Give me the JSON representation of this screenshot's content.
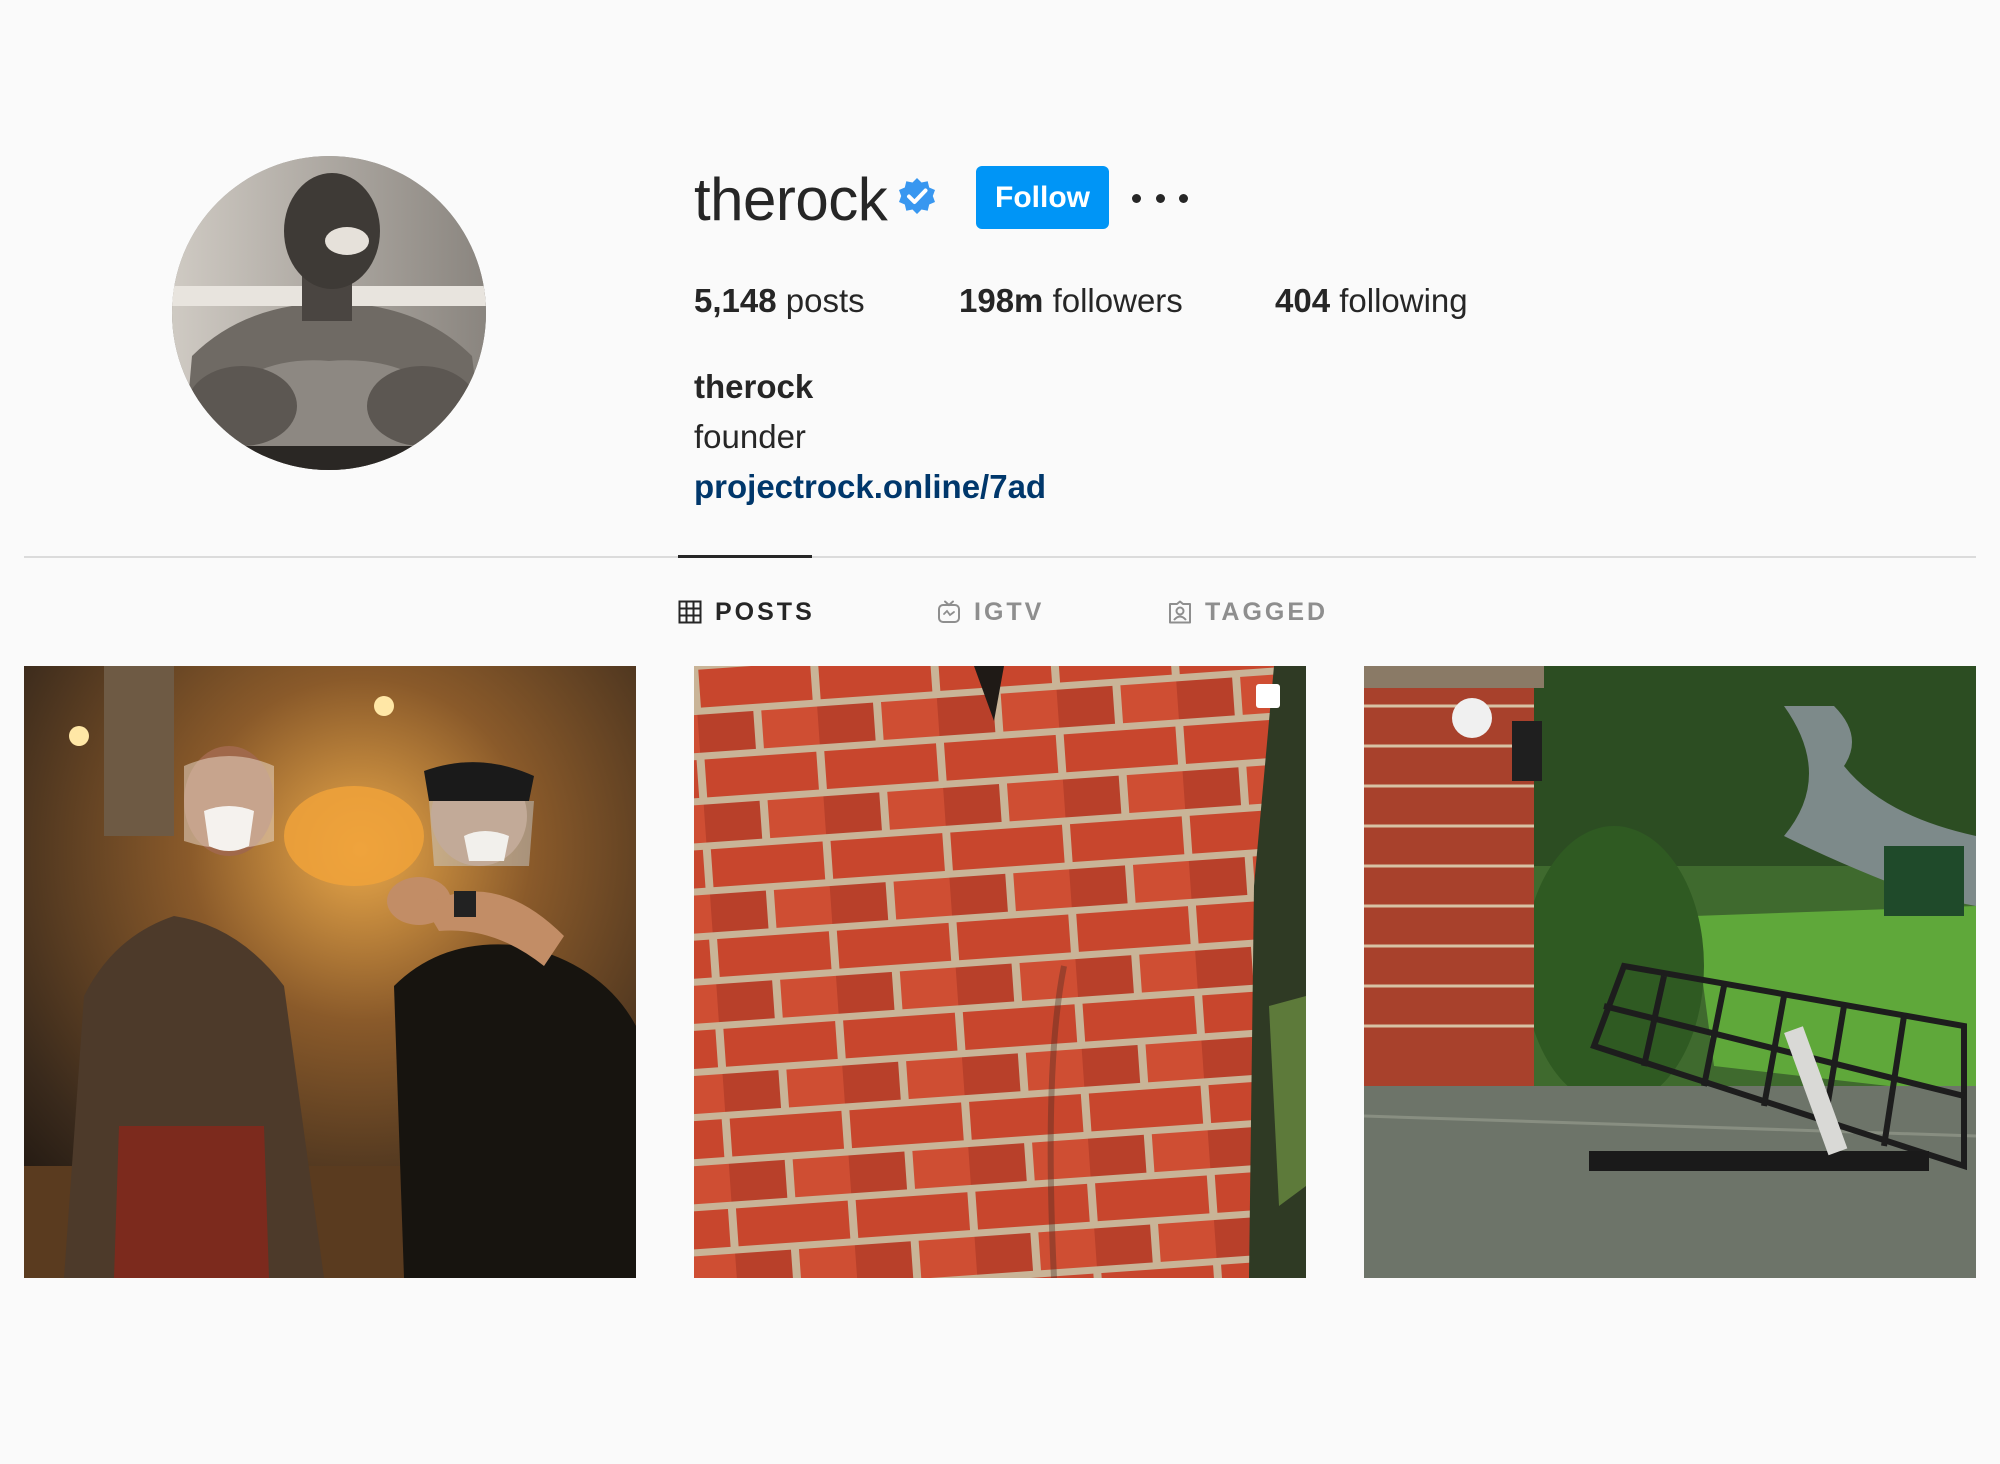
{
  "profile": {
    "username": "therock",
    "verified": true,
    "follow_label": "Follow",
    "more_icon": "more-options-icon",
    "accent_color": "#0095f6",
    "verified_color": "#3897f0",
    "link_color": "#00376b"
  },
  "stats": {
    "posts_count": "5,148",
    "posts_label": "posts",
    "followers_count": "198m",
    "followers_label": "followers",
    "following_count": "404",
    "following_label": "following"
  },
  "bio": {
    "name": "therock",
    "text": "founder",
    "link": "projectrock.online/7ad"
  },
  "tabs": [
    {
      "label": "POSTS",
      "icon": "grid-icon",
      "active": true
    },
    {
      "label": "IGTV",
      "icon": "igtv-icon",
      "active": false
    },
    {
      "label": "TAGGED",
      "icon": "tagged-icon",
      "active": false
    }
  ],
  "posts": [
    {
      "kind": "photo",
      "subject": "two men in face shields in a workshop"
    },
    {
      "kind": "carousel",
      "subject": "red brick wall close-up"
    },
    {
      "kind": "photo",
      "subject": "broken iron gate by brick pillar"
    }
  ]
}
